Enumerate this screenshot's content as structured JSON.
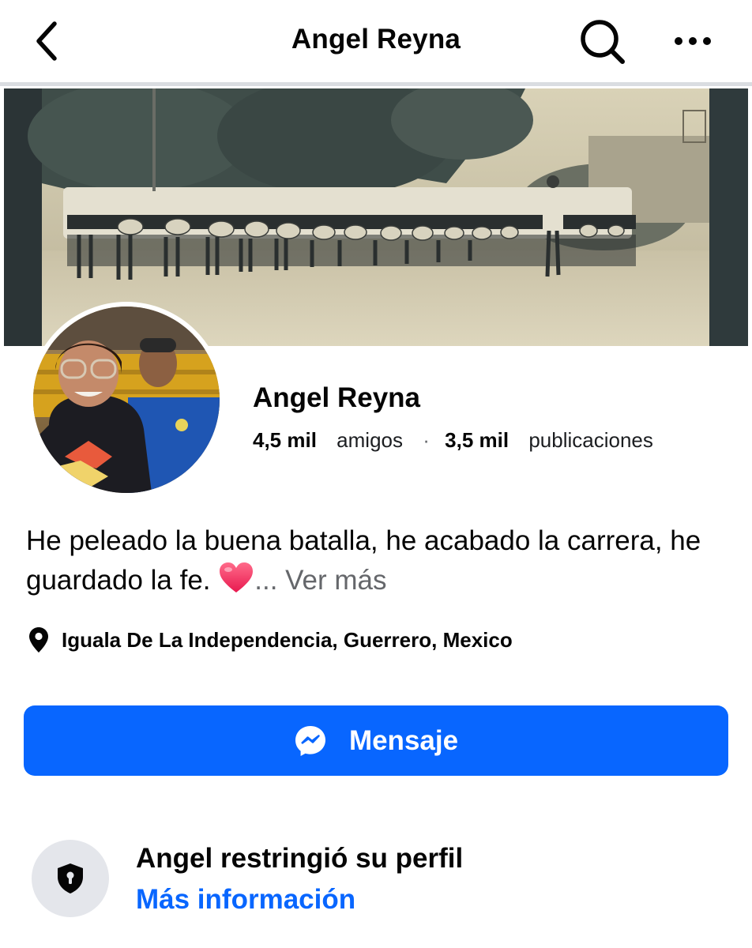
{
  "header": {
    "title": "Angel Reyna",
    "back_icon": "chevron-left-icon",
    "search_icon": "search-icon",
    "more_icon": "more-horizontal-icon"
  },
  "profile": {
    "name": "Angel Reyna",
    "friends_count": "4,5 mil",
    "friends_label": "amigos",
    "separator": "·",
    "posts_count": "3,5 mil",
    "posts_label": "publicaciones"
  },
  "bio": {
    "text": "He peleado la buena batalla, he acabado la carrera, he guardado la fe.",
    "emoji": "❤️",
    "more": "... Ver más"
  },
  "location": {
    "icon": "location-pin-icon",
    "text": "Iguala De La Independencia, Guerrero, Mexico"
  },
  "message_button": {
    "label": "Mensaje",
    "icon": "messenger-icon"
  },
  "restricted": {
    "icon": "shield-lock-icon",
    "title": "Angel restringió su perfil",
    "link": "Más información"
  },
  "colors": {
    "primary": "#0866ff",
    "text": "#050505",
    "secondary": "#65676b",
    "divider": "#dadde1",
    "icon_bg": "#e4e6eb"
  }
}
